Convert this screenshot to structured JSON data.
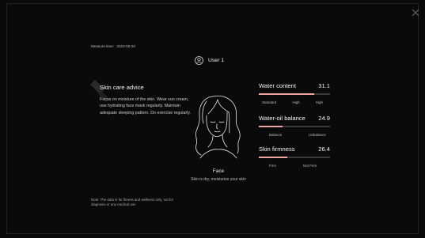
{
  "header": {
    "measure_label": "Measure time:",
    "measure_date": "2023-05-20",
    "user_name": "User 1"
  },
  "advice": {
    "title": "Skin care advice",
    "body": "Focus on moisture of the skin. Wear sun cream, use hydrating face mask regularly. Maintain adequate sleeping pattern. Do exercise regularly."
  },
  "face": {
    "label": "Face",
    "description": "Skin is dry, moisturize your skin"
  },
  "metrics": [
    {
      "name": "Water content",
      "value": "31.1",
      "level": 0.78,
      "scale": [
        "Standard",
        "High",
        "High"
      ]
    },
    {
      "name": "Water-oil balance",
      "value": "24.9",
      "level": 0.33,
      "scale": [
        "Balance",
        "Unbalance"
      ]
    },
    {
      "name": "Skin firmness",
      "value": "26.4",
      "level": 0.4,
      "scale": [
        "Firm",
        "Not Firm"
      ]
    }
  ],
  "note": "Note: The data is for fitness and wellness only, not for diagnosis or any medical use",
  "colors": {
    "background": "#0a0a0a",
    "accent": "#f0a6a2",
    "track": "#3a3a3a"
  },
  "icons": {
    "close": "close-icon",
    "user": "user-avatar-icon",
    "face": "face-outline-illustration"
  }
}
